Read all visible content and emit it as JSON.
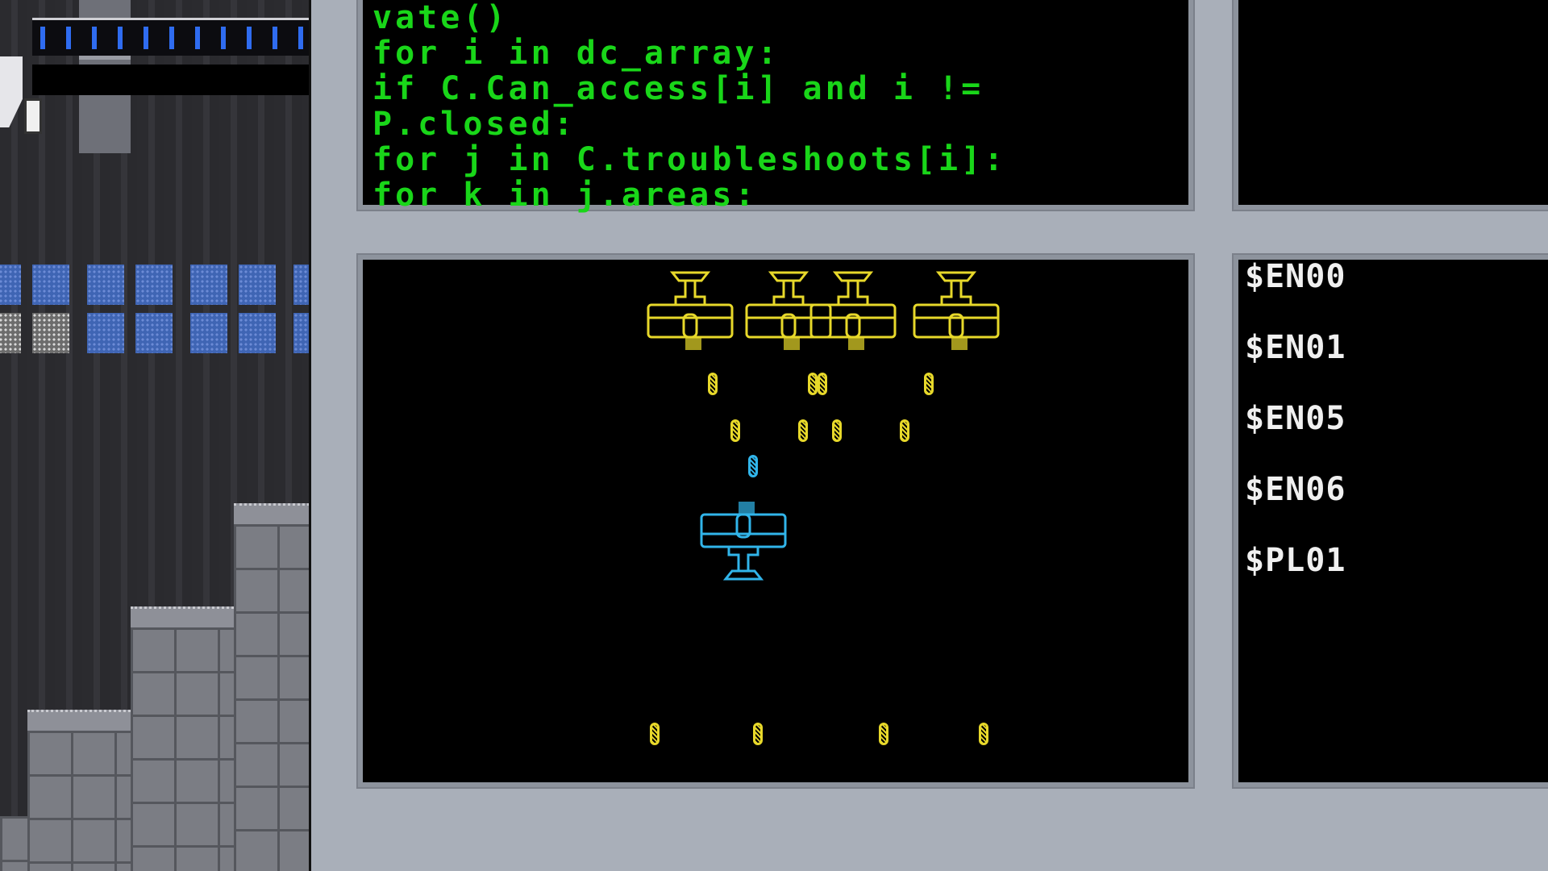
{
  "code_panel": {
    "lines": [
      "vate()",
      "for i in dc_array:",
      "if C.Can_access[i] and i != ",
      "P.closed:",
      "for j in C.troubleshoots[i]:",
      "for k in j.areas:"
    ]
  },
  "entity_list": {
    "labels": [
      "$EN00",
      "$EN01",
      "$EN05",
      "$EN06",
      "$PL01"
    ]
  },
  "game": {
    "enemy_color": "#e7d82a",
    "player_color": "#31b5ea",
    "enemy_count": 4,
    "enemy_bullets_on_screen": 12,
    "player_bullets_on_screen": 1
  },
  "colors": {
    "code_text": "#19d619",
    "panel_bg": "#000000",
    "frame": "#8d939d",
    "background": "#a9afb9",
    "hud_accent": "#2f6cf0"
  },
  "icons": {
    "enemy": "biplane-enemy-icon",
    "player": "biplane-player-icon",
    "bullet": "capsule-bullet-icon"
  }
}
